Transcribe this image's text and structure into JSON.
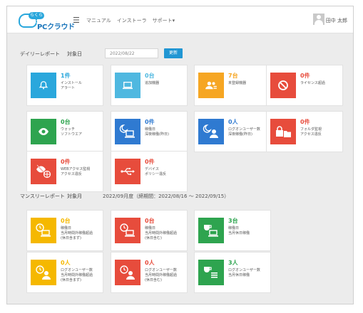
{
  "header": {
    "logo_badge": "らくらく",
    "logo_text": "PCクラウド",
    "menu_icon": "☰",
    "nav": [
      "マニュアル",
      "インストーラ",
      "サポート▾"
    ],
    "username": "田中 太郎"
  },
  "daily": {
    "title": "デイリーレポート",
    "target_label": "対象日",
    "date_value": "2022/08/22",
    "update_button": "更新",
    "cards": [
      {
        "count": "1件",
        "label": [
          "インストール",
          "アラート"
        ],
        "color": "#2aa7dc",
        "icon": "bell-icon"
      },
      {
        "count": "0台",
        "label": [
          "追加機器"
        ],
        "color": "#4fb8e0",
        "icon": "laptop-icon"
      },
      {
        "count": "7台",
        "label": [
          "未登録機器"
        ],
        "color": "#f6a623",
        "icon": "users-icon"
      },
      {
        "count": "0件",
        "label": [
          "ライセンス超過"
        ],
        "color": "#e74c3c",
        "icon": "prohibited-icon"
      },
      {
        "count": "0台",
        "label": [
          "ウォッチ",
          "ソフトウエア"
        ],
        "color": "#2ea44f",
        "icon": "eye-icon"
      },
      {
        "count": "0件",
        "label": [
          "稼働日",
          "深夜稼働(昨日)"
        ],
        "color": "#2f7ad1",
        "icon": "moon-laptop-icon"
      },
      {
        "count": "0人",
        "label": [
          "ログオンユーザー数",
          "深夜稼働(昨日)"
        ],
        "color": "#2f7ad1",
        "icon": "moon-user-icon"
      },
      {
        "count": "0件",
        "label": [
          "フォルダ監視",
          "アクセス違反"
        ],
        "color": "#e74c3c",
        "icon": "folder-lock-icon"
      },
      {
        "count": "0件",
        "label": [
          "WEBアクセス監視",
          "アクセス違反"
        ],
        "color": "#e74c3c",
        "icon": "web-block-icon"
      },
      {
        "count": "0件",
        "label": [
          "デバイス",
          "ポリシー違反"
        ],
        "color": "#e74c3c",
        "icon": "usb-icon"
      }
    ]
  },
  "monthly": {
    "title": "マンスリーレポート",
    "target_label": "対象月",
    "period": "2022/09月度（締期間：2022/08/16 ～ 2022/09/15）",
    "cards": [
      {
        "count": "0台",
        "label": [
          "稼働日",
          "当月時間外稼働超過",
          "(休日含まず)"
        ],
        "color": "#f5b800",
        "icon": "clock-laptop-icon"
      },
      {
        "count": "0台",
        "label": [
          "稼働日",
          "当月時間外稼働超過",
          "(休日含む)"
        ],
        "color": "#e74c3c",
        "icon": "clock-laptop-icon"
      },
      {
        "count": "3台",
        "label": [
          "稼働日",
          "当月休日稼働"
        ],
        "color": "#2ea44f",
        "icon": "cup-laptop-icon"
      },
      {
        "count": "0人",
        "label": [
          "ログオンユーザー数",
          "当月時間外稼働超過",
          "(休日含まず)"
        ],
        "color": "#f5b800",
        "icon": "clock-user-icon"
      },
      {
        "count": "0人",
        "label": [
          "ログオンユーザー数",
          "当月時間外稼働超過",
          "(休日含む)"
        ],
        "color": "#e74c3c",
        "icon": "clock-user-icon"
      },
      {
        "count": "3人",
        "label": [
          "ログオンユーザー数",
          "当月休日稼働"
        ],
        "color": "#2ea44f",
        "icon": "cup-user-icon"
      }
    ]
  }
}
